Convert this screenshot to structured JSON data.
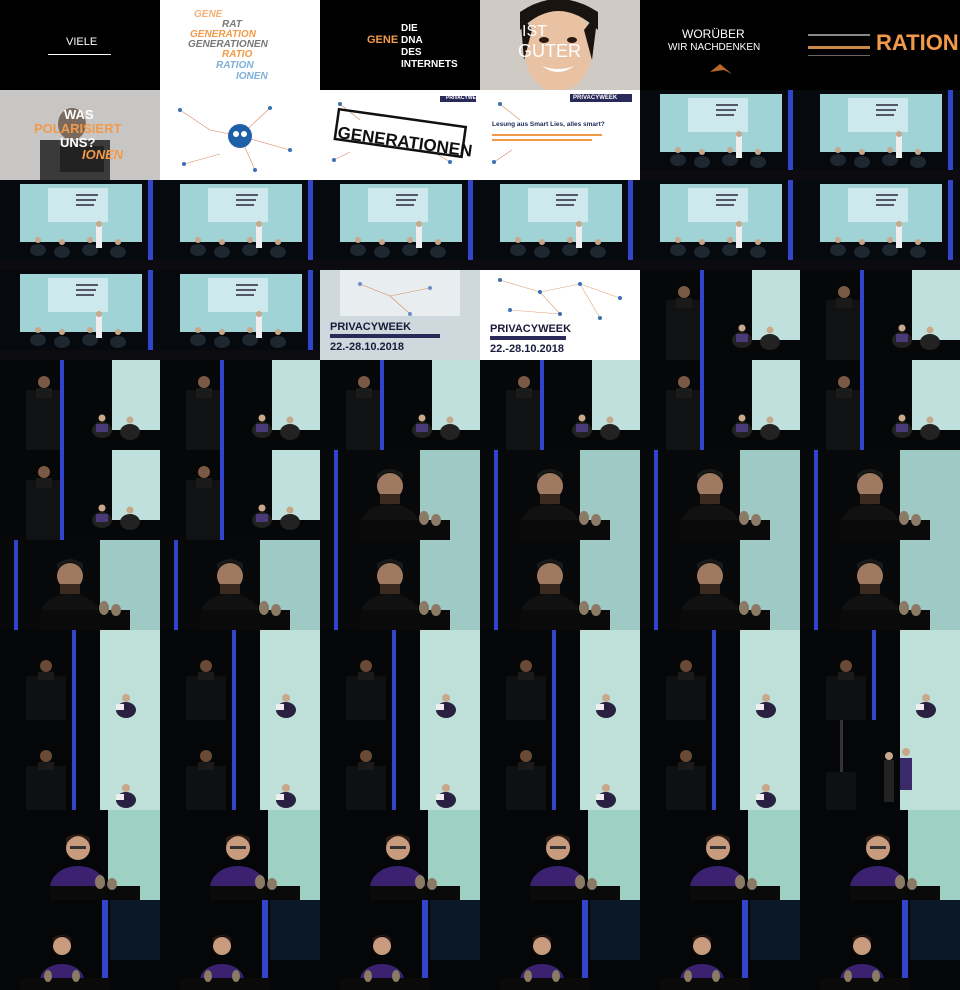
{
  "frames": {
    "viele": "VIELE",
    "gene_words": [
      "GENE",
      "RAT",
      "GENERATION",
      "GENERATIONEN",
      "RATIO",
      "RATION",
      "IONEN"
    ],
    "dna_gene": "GENE",
    "dna_lines": [
      "DIE",
      "DNA",
      "DES",
      "INTERNETS"
    ],
    "ist_guter": [
      "IST",
      "GUTER"
    ],
    "woruber": [
      "WORÜBER",
      "WIR NACHDENKEN"
    ],
    "ration": "RATION",
    "polarisiert": [
      "WAS",
      "POLARISIERT",
      "UNS?",
      "IONEN"
    ],
    "privacyweek_label": "PRIVACYWEEK",
    "generationen_stamp": "GENERATIONEN",
    "lesung_title": "Lesung aus Smart Lies, alles smart?",
    "privacyweek_dates": "22.-28.10.2018"
  },
  "colors": {
    "orange": "#f29a4a",
    "blue_text": "#7fb0d8",
    "stage_wall": "#cfe6e6",
    "truss_blue": "#3344cc"
  }
}
